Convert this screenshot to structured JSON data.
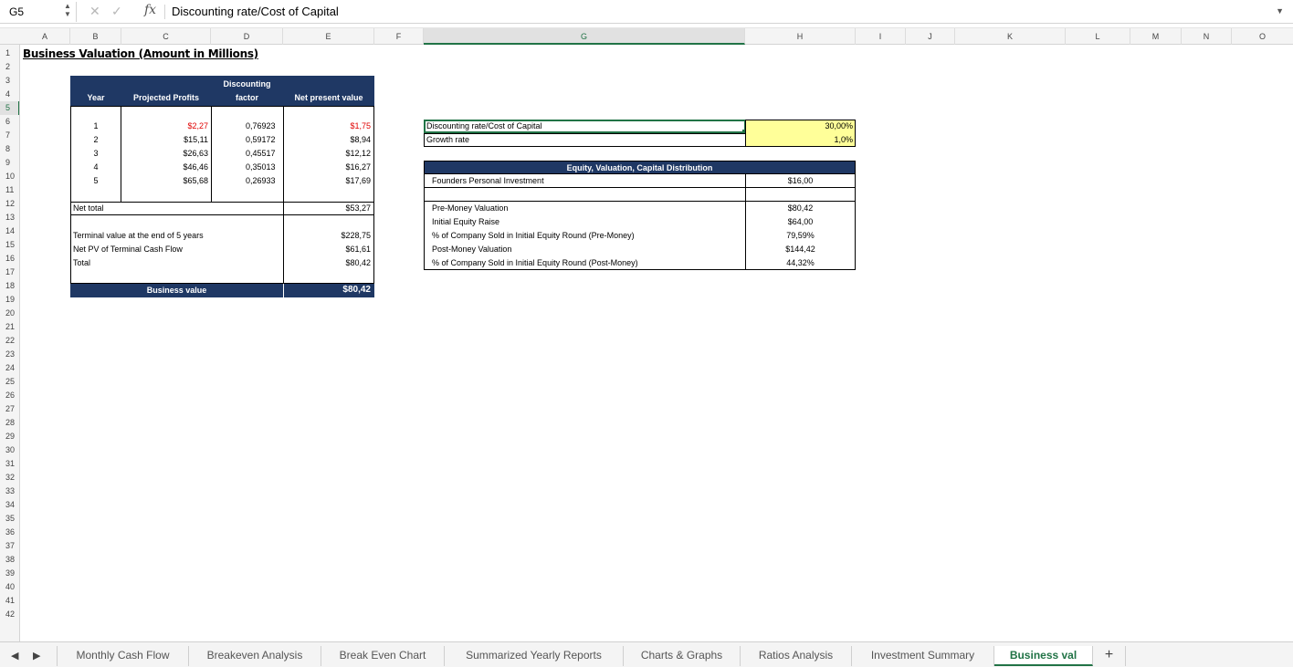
{
  "formula_bar": {
    "cell_ref": "G5",
    "cancel_icon": "close-icon",
    "confirm_icon": "check-icon",
    "fx": "fx",
    "formula": "Discounting rate/Cost of Capital"
  },
  "columns": [
    "A",
    "B",
    "C",
    "D",
    "E",
    "F",
    "G",
    "H",
    "I",
    "J",
    "K",
    "L",
    "M",
    "N",
    "O"
  ],
  "rows": [
    "1",
    "2",
    "3",
    "4",
    "5",
    "6",
    "7",
    "8",
    "9",
    "10",
    "11",
    "12",
    "13",
    "14",
    "15",
    "16",
    "17",
    "18",
    "19",
    "20",
    "21",
    "22",
    "23",
    "24",
    "25",
    "26",
    "27",
    "28",
    "29",
    "30",
    "31",
    "32",
    "33",
    "34",
    "35",
    "36",
    "37",
    "38",
    "39",
    "40",
    "41",
    "42"
  ],
  "selected": {
    "col": "G",
    "row": "5"
  },
  "title": "Business Valuation (Amount in Millions)",
  "npv_table": {
    "headers": {
      "year": "Year",
      "profits": "Projected Profits",
      "factor_line1": "Discounting",
      "factor_line2": "factor",
      "npv": "Net present value"
    },
    "rows": [
      {
        "year": "1",
        "profit": "$2,27",
        "factor": "0,76923",
        "npv": "$1,75"
      },
      {
        "year": "2",
        "profit": "$15,11",
        "factor": "0,59172",
        "npv": "$8,94"
      },
      {
        "year": "3",
        "profit": "$26,63",
        "factor": "0,45517",
        "npv": "$12,12"
      },
      {
        "year": "4",
        "profit": "$46,46",
        "factor": "0,35013",
        "npv": "$16,27"
      },
      {
        "year": "5",
        "profit": "$65,68",
        "factor": "0,26933",
        "npv": "$17,69"
      }
    ],
    "net_total_label": "Net total",
    "net_total_value": "$53,27",
    "terminal_label": "Terminal value at the end of 5 years",
    "terminal_value": "$228,75",
    "net_pv_label": "Net PV of Terminal Cash Flow",
    "net_pv_value": "$61,61",
    "total_label": "Total",
    "total_value": "$80,42",
    "business_value_label": "Business value",
    "business_value": "$80,42"
  },
  "rates": {
    "discount_label": "Discounting rate/Cost of Capital",
    "discount_value": "30,00%",
    "growth_label": "Growth rate",
    "growth_value": "1,0%"
  },
  "equity": {
    "header": "Equity, Valuation, Capital Distribution",
    "founders_label": "Founders Personal Investment",
    "founders_value": "$16,00",
    "rows": [
      {
        "label": "Pre-Money Valuation",
        "value": "$80,42"
      },
      {
        "label": "Initial Equity Raise",
        "value": "$64,00"
      },
      {
        "label": "% of Company Sold in Initial Equity Round (Pre-Money)",
        "value": "79,59%"
      },
      {
        "label": "Post-Money Valuation",
        "value": "$144,42"
      },
      {
        "label": "% of Company Sold in Initial Equity Round (Post-Money)",
        "value": "44,32%"
      }
    ]
  },
  "tabs": [
    "Monthly Cash Flow",
    "Breakeven Analysis",
    "Break Even Chart",
    "Summarized Yearly Reports",
    "Charts & Graphs",
    "Ratios Analysis",
    "Investment Summary",
    "Business val"
  ],
  "add_sheet": "+",
  "colors": {
    "header_blue": "#1f3864",
    "input_yellow": "#ffff99",
    "accent_green": "#217346",
    "negative_red": "#e00000"
  }
}
